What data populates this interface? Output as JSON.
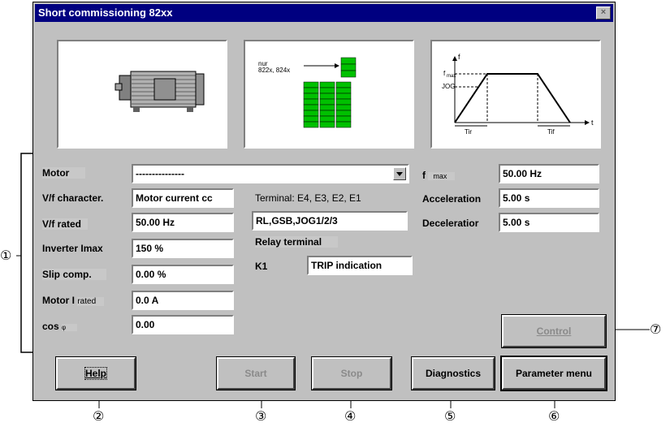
{
  "window": {
    "title": "Short commissioning 82xx",
    "close_glyph": "×"
  },
  "terminal_diagram": {
    "label": "nur\n822x, 824x"
  },
  "ramp_diagram": {
    "y_axis": "f",
    "fmax": "f",
    "fmax_sub": "max",
    "jog": "JOG",
    "t": "t",
    "tir": "Tir",
    "tif": "Tif"
  },
  "left": {
    "motor_label": "Motor",
    "motor_value": "---------------",
    "vf_char_label": "V/f character.",
    "vf_char_value": "Motor current cc",
    "vf_rated_label": "V/f rated",
    "vf_rated_value": "50.00 Hz",
    "imax_label": "Inverter Imax",
    "imax_value": "150 %",
    "slip_label": "Slip comp.",
    "slip_value": "0.00 %",
    "motor_i_label": "Motor I",
    "motor_i_sub": "rated",
    "motor_i_value": "0.0 A",
    "cos_label": "cos",
    "cos_sub": "φ",
    "cos_value": "0.00"
  },
  "middle": {
    "terminal_label": "Terminal: E4, E3, E2, E1",
    "terminal_value": "RL,GSB,JOG1/2/3",
    "relay_label": "Relay terminal",
    "k1_label": "K1",
    "k1_value": "TRIP indication"
  },
  "right": {
    "fmax_label": "f",
    "fmax_sub": "max",
    "fmax_value": "50.00 Hz",
    "acc_label": "Acceleration",
    "acc_value": "5.00 s",
    "dec_label": "Deceleratior",
    "dec_value": "5.00 s"
  },
  "buttons": {
    "control": "Control",
    "help": "Help",
    "start": "Start",
    "stop": "Stop",
    "diagnostics": "Diagnostics",
    "parameter_menu": "Parameter menu"
  },
  "callouts": {
    "c1": "①",
    "c2": "②",
    "c3": "③",
    "c4": "④",
    "c5": "⑤",
    "c6": "⑥",
    "c7": "⑦"
  }
}
